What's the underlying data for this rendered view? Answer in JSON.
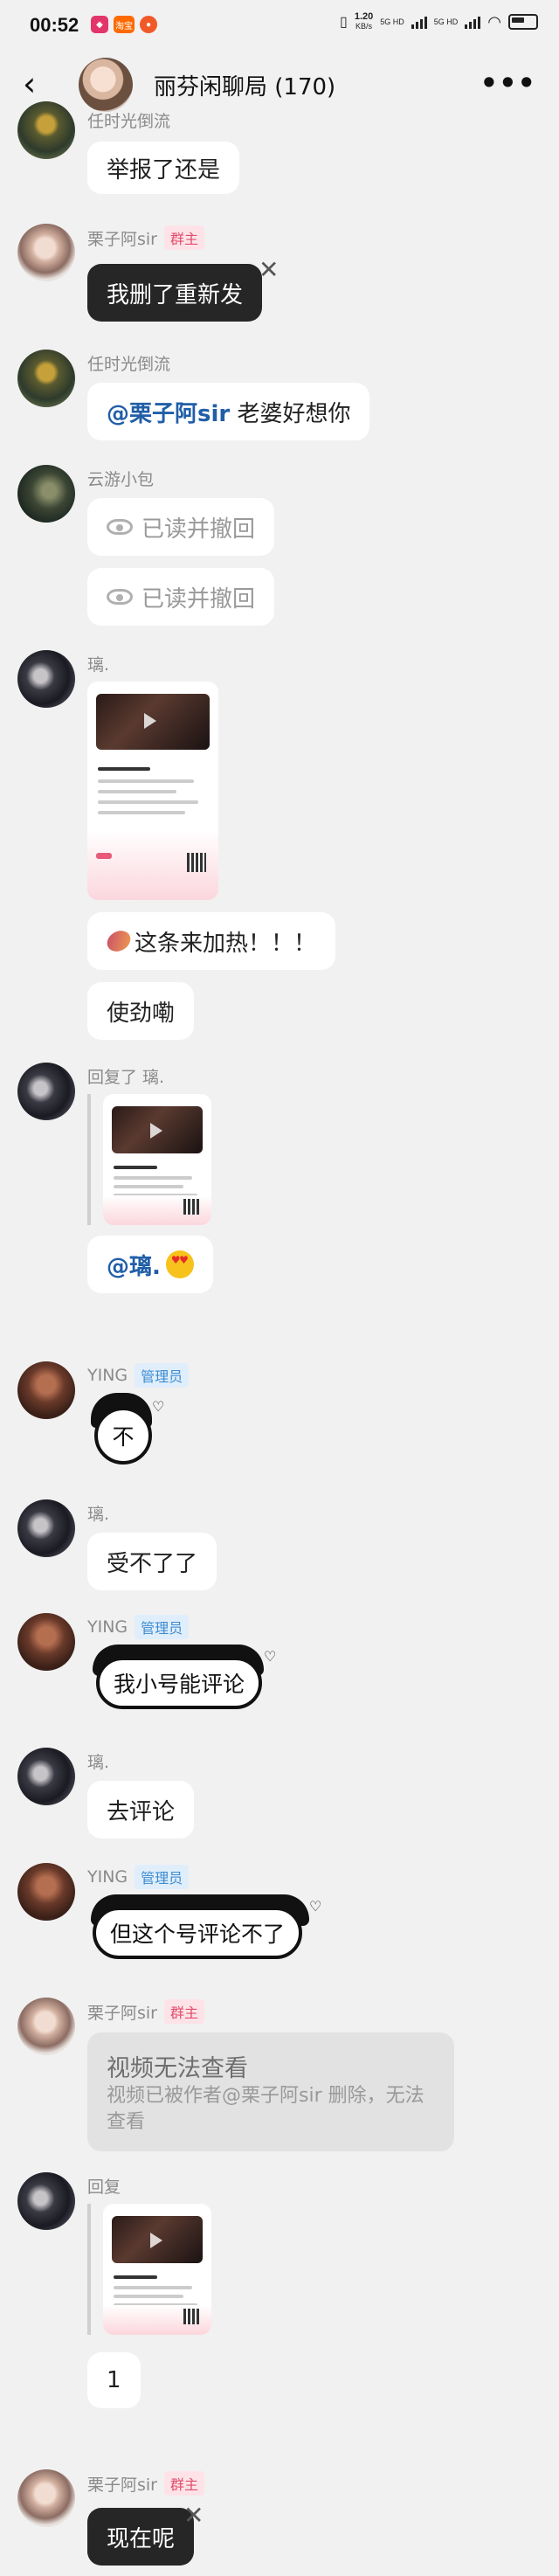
{
  "status_bar": {
    "time": "00:52",
    "net_speed": "1.20",
    "net_unit": "KB/s",
    "net1": "5G HD",
    "net2": "5G HD",
    "app_badge": "淘宝"
  },
  "header": {
    "back": "‹",
    "title": "丽芬闲聊局 (170)",
    "more": "•••"
  },
  "messages": [
    {
      "sender": "任时光倒流",
      "text": "举报了还是"
    },
    {
      "sender": "栗子阿sir",
      "badge": "群主",
      "text": "我删了重新发"
    },
    {
      "sender": "任时光倒流",
      "mention": "@栗子阿sir",
      "text": " 老婆好想你"
    },
    {
      "sender": "云游小包",
      "recall1": "已读并撤回",
      "recall2": "已读并撤回"
    },
    {
      "sender": "璃.",
      "text1": "这条来加热！！！",
      "text2": "使劲嘞"
    },
    {
      "sender": "回复了 璃.",
      "mention": "@璃."
    },
    {
      "sender": "YING",
      "badge": "管理员",
      "sticker": "不"
    },
    {
      "sender": "璃.",
      "text": "受不了了"
    },
    {
      "sender": "YING",
      "badge": "管理员",
      "sticker": "我小号能评论"
    },
    {
      "sender": "璃.",
      "text": "去评论"
    },
    {
      "sender": "YING",
      "badge": "管理员",
      "sticker": "但这个号评论不了"
    },
    {
      "sender": "栗子阿sir",
      "badge": "群主",
      "invalid_title": "视频无法查看",
      "invalid_desc": "视频已被作者@栗子阿sir 删除，无法查看"
    },
    {
      "sender": "回复",
      "text": "1"
    },
    {
      "sender": "栗子阿sir",
      "badge": "群主",
      "text": "现在呢"
    }
  ],
  "icons": [
    "back-arrow-icon",
    "more-icon",
    "eye-icon",
    "close-icon",
    "play-icon",
    "qr-icon",
    "heart-eyes-emoji",
    "sweet-potato-emoji"
  ]
}
